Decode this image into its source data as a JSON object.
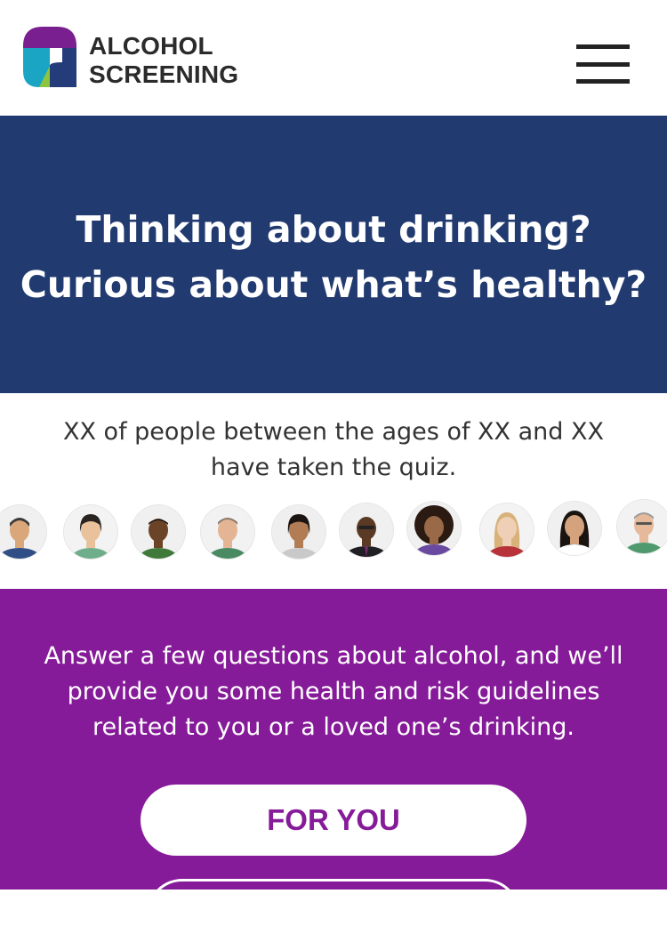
{
  "brand": {
    "line1": "ALCOHOL",
    "line2": "SCREENING"
  },
  "nav": {
    "menu_icon": "hamburger-menu-icon"
  },
  "hero": {
    "line1": "Thinking about drinking?",
    "line2": "Curious about what’s healthy?"
  },
  "stats": {
    "line1": "XX of people between the ages of XX and XX",
    "line2": "have taken the quiz."
  },
  "cta": {
    "line1": "Answer a few questions about alcohol, and we’ll",
    "line2": "provide you some health and risk guidelines",
    "line3": "related to you or a loved one’s drinking.",
    "primary_button": "FOR YOU"
  },
  "colors": {
    "hero_bg": "#213a70",
    "cta_bg": "#861b99",
    "logo_purple": "#7a1f8f",
    "logo_teal": "#1aa5c4",
    "logo_green": "#8cc63f",
    "logo_navy": "#243c7a"
  }
}
